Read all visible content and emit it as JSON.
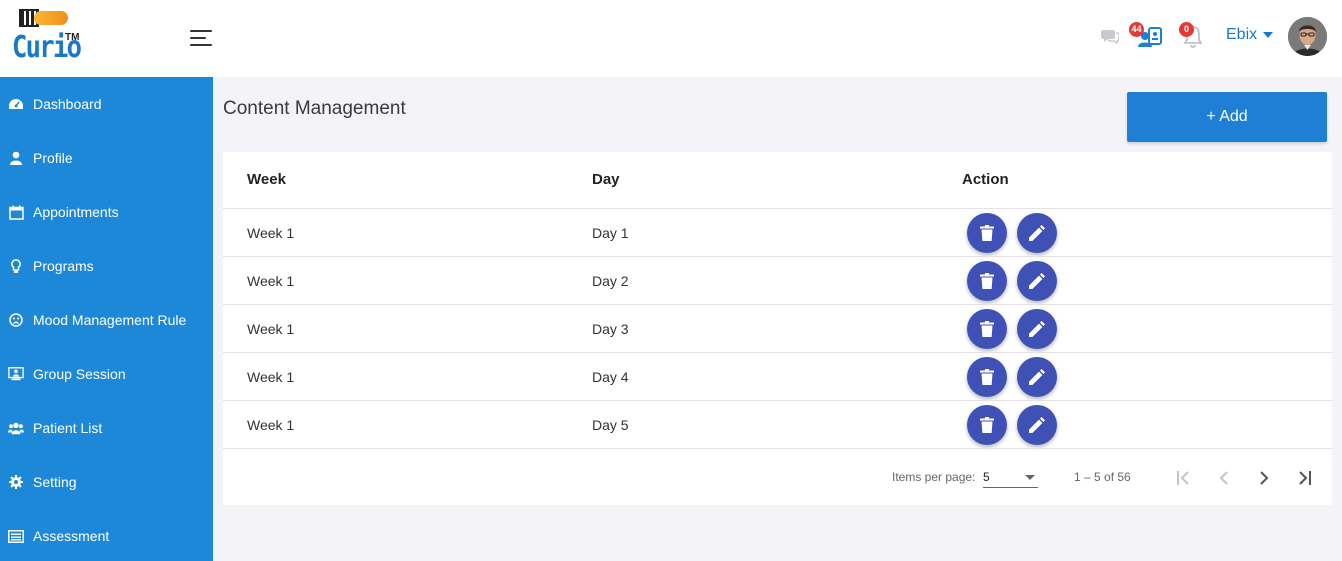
{
  "header": {
    "logo_text": "Curio",
    "logo_tm": "TM",
    "messages_badge": "44",
    "notifications_badge": "0",
    "user_name": "Ebix"
  },
  "sidebar": {
    "items": [
      {
        "label": "Dashboard",
        "icon": "dashboard-icon"
      },
      {
        "label": "Profile",
        "icon": "user-icon"
      },
      {
        "label": "Appointments",
        "icon": "calendar-icon"
      },
      {
        "label": "Programs",
        "icon": "lightbulb-icon"
      },
      {
        "label": "Mood Management Rule",
        "icon": "frown-icon"
      },
      {
        "label": "Group Session",
        "icon": "group-session-icon"
      },
      {
        "label": "Patient List",
        "icon": "users-icon"
      },
      {
        "label": "Setting",
        "icon": "gear-icon"
      },
      {
        "label": "Assessment",
        "icon": "list-icon"
      }
    ]
  },
  "main": {
    "title": "Content Management",
    "add_label": "+ Add",
    "table": {
      "headers": [
        "Week",
        "Day",
        "Action"
      ],
      "rows": [
        {
          "week": "Week 1",
          "day": "Day 1"
        },
        {
          "week": "Week 1",
          "day": "Day 2"
        },
        {
          "week": "Week 1",
          "day": "Day 3"
        },
        {
          "week": "Week 1",
          "day": "Day 4"
        },
        {
          "week": "Week 1",
          "day": "Day 5"
        }
      ]
    },
    "paginator": {
      "items_per_page_label": "Items per page:",
      "items_per_page_value": "5",
      "range_label": "1 – 5 of 56"
    }
  },
  "colors": {
    "brand_blue": "#1e88d8",
    "action_indigo": "#3f51b5",
    "badge_red": "#e53935"
  }
}
